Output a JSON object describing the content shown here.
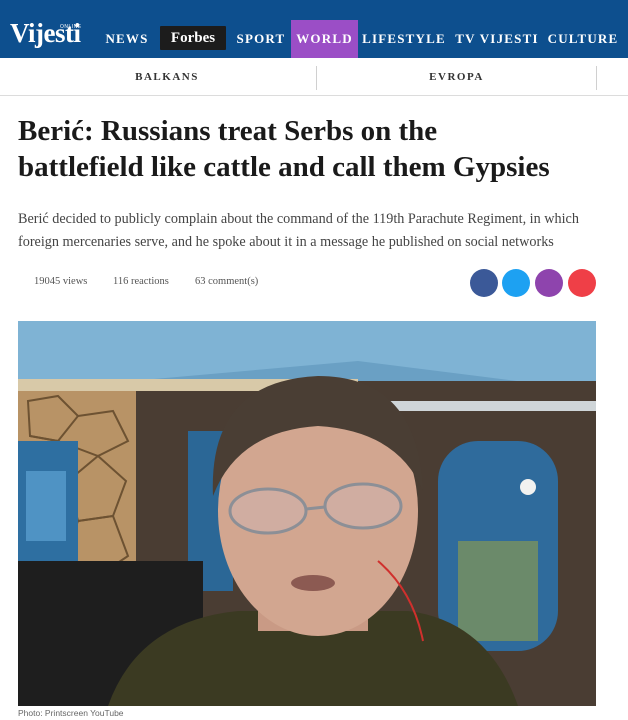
{
  "header": {
    "logo": "Vijesti",
    "logo_sup": "ONLINE",
    "nav": [
      "NEWS",
      "Forbes",
      "SPORT",
      "WORLD",
      "LIFESTYLE",
      "TV VIJESTI",
      "CULTURE"
    ],
    "active": "WORLD"
  },
  "subnav": [
    "BALKANS",
    "EVROPA"
  ],
  "article": {
    "title_line1": "Berić: Russians treat Serbs on the",
    "title_line2": "battlefield like cattle and call them Gypsies",
    "lede_line1": "Berić decided to publicly complain about the command of the 119th Parachute Regiment, in which",
    "lede_line2": "foreign mercenaries serve, and he spoke about it in a message he published on social networks",
    "views": "19045 views",
    "reactions": "116 reactions",
    "comments": "63 comment(s)",
    "photo_caption": "Photo: Printscreen YouTube"
  },
  "share": [
    {
      "name": "facebook-share",
      "color": "#3b5998"
    },
    {
      "name": "twitter-share",
      "color": "#1da1f2"
    },
    {
      "name": "viber-share",
      "color": "#8e44ad"
    },
    {
      "name": "email-share",
      "color": "#ef3f47"
    }
  ],
  "colors": {
    "brand_blue": "#0d4f8e",
    "world_purple": "#9b4ec6",
    "forbes_black": "#1c1c1c"
  }
}
